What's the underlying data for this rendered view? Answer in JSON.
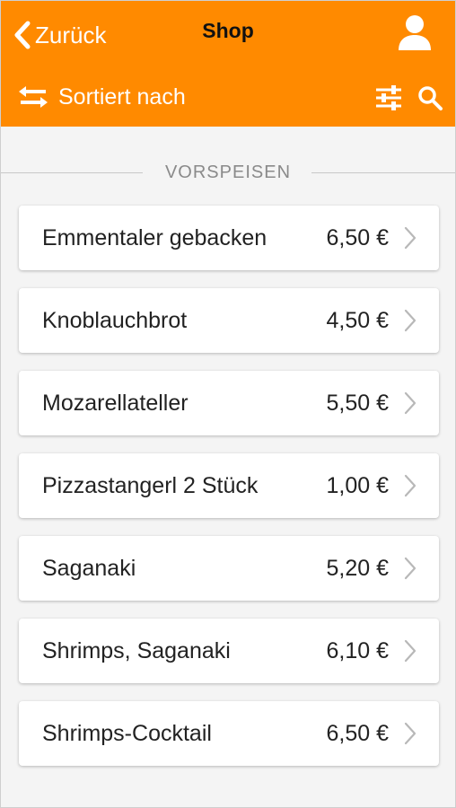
{
  "header": {
    "back_label": "Zurück",
    "title": "Shop",
    "sort_label": "Sortiert nach"
  },
  "icons": {
    "back": "chevron-left-icon",
    "user": "user-icon",
    "sort": "swap-arrows-icon",
    "filter": "filter-sliders-icon",
    "search": "search-icon",
    "item_arrow": "chevron-right-icon"
  },
  "colors": {
    "accent": "#ff8a00",
    "background": "#f4f4f4"
  },
  "section": {
    "title": "VORSPEISEN"
  },
  "items": [
    {
      "name": "Emmentaler gebacken",
      "price": "6,50 €"
    },
    {
      "name": "Knoblauchbrot",
      "price": "4,50 €"
    },
    {
      "name": "Mozarellateller",
      "price": "5,50 €"
    },
    {
      "name": "Pizzastangerl 2 Stück",
      "price": "1,00 €"
    },
    {
      "name": "Saganaki",
      "price": "5,20 €"
    },
    {
      "name": "Shrimps, Saganaki",
      "price": "6,10 €"
    },
    {
      "name": "Shrimps-Cocktail",
      "price": "6,50 €"
    }
  ]
}
